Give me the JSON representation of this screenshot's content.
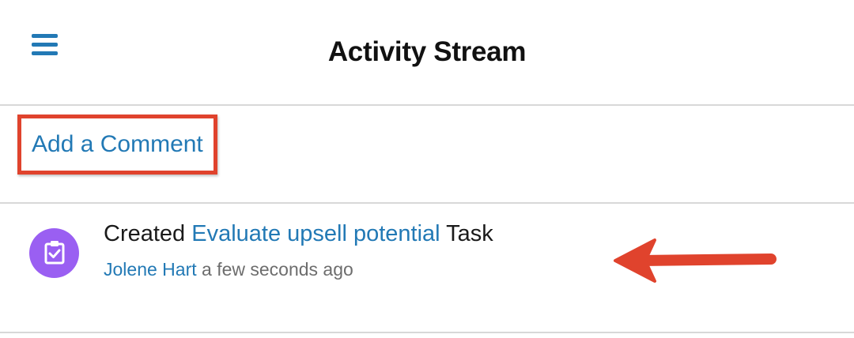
{
  "header": {
    "title": "Activity Stream",
    "menu_icon": "hamburger-menu-icon"
  },
  "add_comment": {
    "label": "Add a Comment"
  },
  "activity": {
    "verb": "Created",
    "record_name": "Evaluate upsell potential",
    "record_type": "Task",
    "user": "Jolene Hart",
    "time": "a few seconds ago",
    "icon": "task-clipboard-check-icon",
    "icon_color": "#9a5ff2"
  },
  "annotations": {
    "highlight_color": "#e0432d",
    "arrow_color": "#e0432d"
  },
  "colors": {
    "link": "#2279b5",
    "text": "#1a1a1a",
    "muted": "#6d6d6d",
    "divider": "#d8d8d8"
  }
}
